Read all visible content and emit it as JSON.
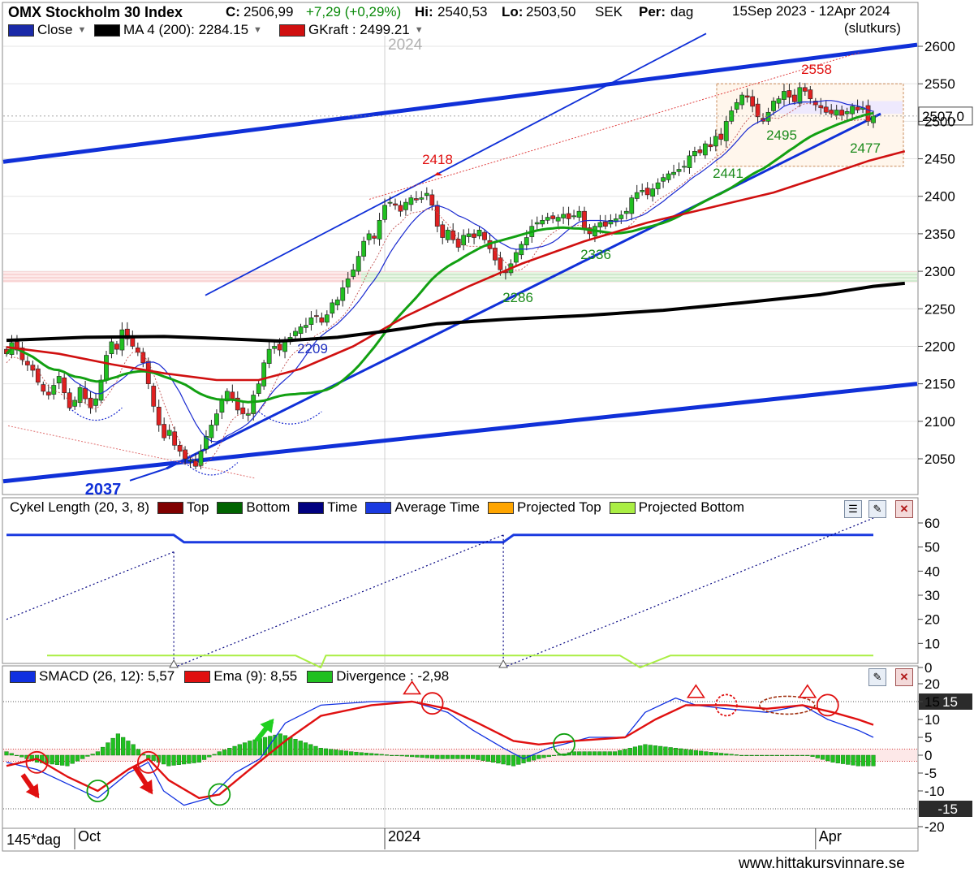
{
  "header": {
    "title": "OMX Stockholm 30 Index",
    "close_label": "C:",
    "close_value": "2506,99",
    "change": "+7,29 (+0,29%)",
    "high_label": "Hi:",
    "high_value": "2540,53",
    "low_label": "Lo:",
    "low_value": "2503,50",
    "currency": "SEK",
    "period_label": "Per:",
    "period_value": "dag",
    "date_range": "15Sep 2023 - 12Apr 2024",
    "price_type": "(slutkurs)"
  },
  "price_legend": [
    {
      "label": "Close",
      "color": "#1a2aa8"
    },
    {
      "label": "MA 4 (200): 2284.15",
      "color": "#000000"
    },
    {
      "label": "GKraft : 2499.21",
      "color": "#d01010"
    }
  ],
  "cycle_legend": {
    "title": "Cykel Length (20, 3, 8)",
    "items": [
      {
        "label": "Top",
        "color": "#800000"
      },
      {
        "label": "Bottom",
        "color": "#006400"
      },
      {
        "label": "Time",
        "color": "#000080"
      },
      {
        "label": "Average Time",
        "color": "#1a3ae0"
      },
      {
        "label": "Projected Top",
        "color": "#ffa500"
      },
      {
        "label": "Projected Bottom",
        "color": "#aaee44"
      }
    ]
  },
  "macd_legend": [
    {
      "label": "SMACD (26, 12): 5,57",
      "color": "#1030e0"
    },
    {
      "label": "Ema (9): 8,55",
      "color": "#e01010"
    },
    {
      "label": "Divergence : -2,98",
      "color": "#20c020"
    }
  ],
  "footer": {
    "zoom": "145*dag",
    "website": "www.hittakursvinnare.se"
  },
  "icons": [
    "document-icon",
    "wrench-icon",
    "close-icon"
  ],
  "chart_data": [
    {
      "type": "candlestick",
      "title": "OMX Stockholm 30 Index",
      "ylim": [
        2005,
        2620
      ],
      "y_ticks": [
        2050,
        2100,
        2150,
        2200,
        2250,
        2300,
        2350,
        2400,
        2450,
        2500,
        2550,
        2600
      ],
      "x_tick_labels": [
        "Oct",
        "2024",
        "Apr"
      ],
      "year_watermark": "2024",
      "last_price_label": "2507,0",
      "closes": [
        2190,
        2205,
        2195,
        2182,
        2175,
        2168,
        2152,
        2140,
        2135,
        2148,
        2160,
        2138,
        2118,
        2128,
        2145,
        2130,
        2118,
        2130,
        2155,
        2188,
        2206,
        2196,
        2222,
        2210,
        2200,
        2192,
        2178,
        2150,
        2120,
        2095,
        2078,
        2088,
        2068,
        2060,
        2050,
        2048,
        2040,
        2060,
        2080,
        2095,
        2110,
        2130,
        2140,
        2130,
        2115,
        2110,
        2110,
        2135,
        2150,
        2178,
        2196,
        2200,
        2195,
        2206,
        2212,
        2220,
        2226,
        2228,
        2238,
        2240,
        2232,
        2242,
        2258,
        2262,
        2278,
        2290,
        2302,
        2320,
        2340,
        2350,
        2344,
        2368,
        2388,
        2392,
        2388,
        2380,
        2392,
        2398,
        2395,
        2398,
        2404,
        2388,
        2360,
        2345,
        2355,
        2342,
        2332,
        2348,
        2350,
        2345,
        2355,
        2342,
        2330,
        2315,
        2302,
        2298,
        2310,
        2325,
        2336,
        2345,
        2360,
        2365,
        2368,
        2372,
        2370,
        2372,
        2376,
        2370,
        2374,
        2380,
        2356,
        2350,
        2360,
        2365,
        2360,
        2368,
        2370,
        2375,
        2380,
        2398,
        2405,
        2408,
        2402,
        2410,
        2418,
        2425,
        2430,
        2432,
        2436,
        2440,
        2454,
        2460,
        2458,
        2470,
        2466,
        2480,
        2476,
        2500,
        2514,
        2525,
        2535,
        2532,
        2520,
        2506,
        2500,
        2512,
        2527,
        2530,
        2540,
        2532,
        2526,
        2545,
        2540,
        2530,
        2522,
        2518,
        2512,
        2510,
        2515,
        2508,
        2513,
        2520,
        2515,
        2518,
        2500,
        2507
      ],
      "annotations": [
        {
          "text": "2418",
          "kind": "top"
        },
        {
          "text": "2558",
          "kind": "top"
        },
        {
          "text": "2209",
          "kind": "bottom"
        },
        {
          "text": "2286",
          "kind": "bottom"
        },
        {
          "text": "2336",
          "kind": "bottom"
        },
        {
          "text": "2441",
          "kind": "bottom"
        },
        {
          "text": "2495",
          "kind": "bottom"
        },
        {
          "text": "2477",
          "kind": "bottom"
        },
        {
          "text": "2037",
          "kind": "bottom"
        }
      ],
      "series": [
        {
          "name": "MA 4 (200): 2284.15",
          "color": "#000000",
          "values": [
            [
              0,
              2208
            ],
            [
              15,
              2212
            ],
            [
              30,
              2213
            ],
            [
              42,
              2210
            ],
            [
              52,
              2207
            ],
            [
              63,
              2212
            ],
            [
              72,
              2220
            ],
            [
              82,
              2230
            ],
            [
              95,
              2236
            ],
            [
              110,
              2241
            ],
            [
              125,
              2248
            ],
            [
              140,
              2258
            ],
            [
              155,
              2269
            ],
            [
              165,
              2280
            ],
            [
              171,
              2284
            ]
          ]
        },
        {
          "name": "GKraft : 2499.21",
          "color": "#d01010",
          "values": [
            [
              0,
              2199
            ],
            [
              10,
              2190
            ],
            [
              20,
              2176
            ],
            [
              30,
              2164
            ],
            [
              40,
              2155
            ],
            [
              48,
              2155
            ],
            [
              56,
              2170
            ],
            [
              66,
              2200
            ],
            [
              76,
              2240
            ],
            [
              88,
              2280
            ],
            [
              98,
              2310
            ],
            [
              110,
              2340
            ],
            [
              122,
              2365
            ],
            [
              134,
              2385
            ],
            [
              146,
              2405
            ],
            [
              156,
              2428
            ],
            [
              164,
              2447
            ],
            [
              171,
              2460
            ]
          ]
        }
      ]
    },
    {
      "type": "line",
      "title": "Cykel Length (20, 3, 8)",
      "ylim": [
        -2,
        64
      ],
      "y_ticks": [
        0,
        10,
        20,
        30,
        40,
        50,
        60
      ],
      "series": [
        {
          "name": "Average Time",
          "color": "#1a3ae0",
          "values": [
            [
              0,
              55
            ],
            [
              33,
              55
            ],
            [
              35,
              52
            ],
            [
              98,
              52
            ],
            [
              100,
              55
            ],
            [
              171,
              55
            ]
          ]
        },
        {
          "name": "Time",
          "color": "#000080",
          "values": [
            [
              0,
              20
            ],
            [
              33,
              48
            ],
            [
              33,
              0
            ],
            [
              98,
              55
            ],
            [
              98,
              0
            ],
            [
              171,
              62
            ]
          ]
        },
        {
          "name": "Projected Bottom",
          "color": "#aaee44",
          "values": [
            [
              8,
              5
            ],
            [
              57,
              5
            ],
            [
              62,
              0
            ],
            [
              63,
              5
            ],
            [
              121,
              5
            ],
            [
              125,
              0
            ],
            [
              131,
              5
            ],
            [
              171,
              5
            ]
          ]
        }
      ]
    },
    {
      "type": "line",
      "title": "SMACD (26, 12)",
      "ylim": [
        -21,
        21
      ],
      "y_ticks": [
        -20,
        -10,
        -5.0,
        0,
        5.0,
        10,
        15,
        20
      ],
      "band_labels": [
        "15",
        "-15"
      ],
      "series": [
        {
          "name": "SMACD (26, 12): 5,57",
          "color": "#1030e0",
          "values": [
            [
              0,
              -2
            ],
            [
              6,
              -4
            ],
            [
              12,
              -8
            ],
            [
              18,
              -12
            ],
            [
              24,
              -5
            ],
            [
              28,
              -2
            ],
            [
              31,
              -10
            ],
            [
              35,
              -14
            ],
            [
              40,
              -12
            ],
            [
              45,
              -5
            ],
            [
              50,
              -1
            ],
            [
              55,
              9
            ],
            [
              62,
              14
            ],
            [
              72,
              15
            ],
            [
              80,
              15
            ],
            [
              87,
              12
            ],
            [
              92,
              7
            ],
            [
              98,
              2
            ],
            [
              102,
              -1
            ],
            [
              107,
              2
            ],
            [
              115,
              5
            ],
            [
              122,
              5
            ],
            [
              126,
              12
            ],
            [
              132,
              16
            ],
            [
              136,
              14
            ],
            [
              142,
              13
            ],
            [
              150,
              12
            ],
            [
              157,
              14
            ],
            [
              162,
              10
            ],
            [
              168,
              7
            ],
            [
              171,
              5
            ]
          ]
        },
        {
          "name": "Ema (9): 8,55",
          "color": "#e01010",
          "values": [
            [
              0,
              -3
            ],
            [
              6,
              -1
            ],
            [
              12,
              -6
            ],
            [
              18,
              -10
            ],
            [
              24,
              -4
            ],
            [
              28,
              -1
            ],
            [
              32,
              -7
            ],
            [
              38,
              -12
            ],
            [
              42,
              -11
            ],
            [
              48,
              -4
            ],
            [
              55,
              4
            ],
            [
              62,
              11
            ],
            [
              72,
              14
            ],
            [
              80,
              15
            ],
            [
              87,
              13
            ],
            [
              93,
              9
            ],
            [
              100,
              4
            ],
            [
              105,
              3
            ],
            [
              112,
              4
            ],
            [
              122,
              5
            ],
            [
              128,
              10
            ],
            [
              134,
              14
            ],
            [
              142,
              14
            ],
            [
              150,
              13
            ],
            [
              157,
              14
            ],
            [
              163,
              12
            ],
            [
              168,
              10
            ],
            [
              171,
              8.5
            ]
          ]
        },
        {
          "name": "Divergence : -2,98",
          "color": "#20c020",
          "values": [
            [
              0,
              1
            ],
            [
              6,
              -2
            ],
            [
              12,
              -3
            ],
            [
              18,
              1
            ],
            [
              22,
              6
            ],
            [
              25,
              3
            ],
            [
              28,
              -1
            ],
            [
              32,
              -3
            ],
            [
              38,
              -2
            ],
            [
              42,
              1
            ],
            [
              48,
              4
            ],
            [
              54,
              6
            ],
            [
              58,
              4
            ],
            [
              62,
              2
            ],
            [
              68,
              1
            ],
            [
              76,
              0
            ],
            [
              85,
              -1
            ],
            [
              92,
              -1
            ],
            [
              100,
              -3
            ],
            [
              105,
              -1
            ],
            [
              112,
              1
            ],
            [
              120,
              1
            ],
            [
              126,
              3
            ],
            [
              132,
              2
            ],
            [
              138,
              1
            ],
            [
              145,
              0
            ],
            [
              152,
              0
            ],
            [
              158,
              0
            ],
            [
              163,
              -2
            ],
            [
              168,
              -3
            ],
            [
              171,
              -3
            ]
          ]
        }
      ]
    }
  ]
}
